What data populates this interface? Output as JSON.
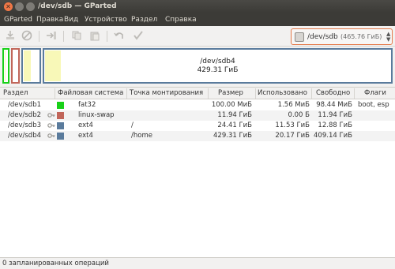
{
  "window": {
    "title": "/dev/sdb — GParted"
  },
  "menu": [
    "GParted",
    "Правка",
    "Вид",
    "Устройство",
    "Раздел",
    "Справка"
  ],
  "device": {
    "name": "/dev/sdb",
    "size": "(465.76 ГиБ)"
  },
  "map": {
    "large_name": "/dev/sdb4",
    "large_size": "429.31 ГиБ",
    "colors": {
      "fat32": "#18d018",
      "linux-swap": "#c1665a",
      "ext4": "#5a7b9c"
    }
  },
  "table": {
    "headers": [
      "Раздел",
      "Файловая система",
      "Точка монтирования",
      "Размер",
      "Использовано",
      "Свободно",
      "Флаги"
    ],
    "rows": [
      {
        "partition": "/dev/sdb1",
        "fs": "fat32",
        "fs_color": "#18d018",
        "mount": "",
        "size": "100.00 МиБ",
        "used": "1.56 МиБ",
        "free": "98.44 МиБ",
        "flags": "boot, esp",
        "locked": false
      },
      {
        "partition": "/dev/sdb2",
        "fs": "linux-swap",
        "fs_color": "#c1665a",
        "mount": "",
        "size": "11.94 ГиБ",
        "used": "0.00 Б",
        "free": "11.94 ГиБ",
        "flags": "",
        "locked": true
      },
      {
        "partition": "/dev/sdb3",
        "fs": "ext4",
        "fs_color": "#5a7b9c",
        "mount": "/",
        "size": "24.41 ГиБ",
        "used": "11.53 ГиБ",
        "free": "12.88 ГиБ",
        "flags": "",
        "locked": true
      },
      {
        "partition": "/dev/sdb4",
        "fs": "ext4",
        "fs_color": "#5a7b9c",
        "mount": "/home",
        "size": "429.31 ГиБ",
        "used": "20.17 ГиБ",
        "free": "409.14 ГиБ",
        "flags": "",
        "locked": true
      }
    ]
  },
  "status": {
    "text": "0 запланированных операций"
  }
}
